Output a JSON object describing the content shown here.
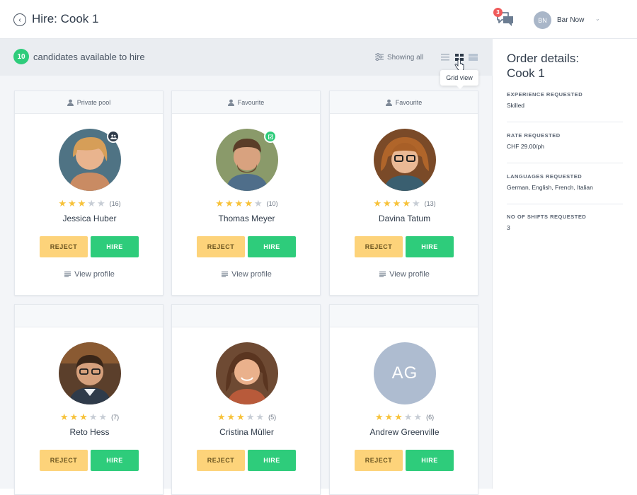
{
  "header": {
    "back_glyph": "‹",
    "title": "Hire: Cook 1",
    "message_count": "3",
    "user_initials": "BN",
    "user_name": "Bar Now",
    "caret": "⌄"
  },
  "subbar": {
    "count": "10",
    "count_label": "candidates available to hire",
    "filter_label": "Showing all",
    "tooltip": "Grid view"
  },
  "candidates": [
    {
      "pool": "Private pool",
      "name": "Jessica Huber",
      "stars": 3,
      "reviews": "(16)",
      "reject": "REJECT",
      "hire": "HIRE",
      "view_profile": "View profile",
      "photo_bg": "#c98b63",
      "badge": "group-icon",
      "badge_color": "#2f3b4a"
    },
    {
      "pool": "Favourite",
      "name": "Thomas Meyer",
      "stars": 4,
      "reviews": "(10)",
      "reject": "REJECT",
      "hire": "HIRE",
      "view_profile": "View profile",
      "photo_bg": "#8a6d52",
      "badge": "favourite-icon",
      "badge_color": "#2ecc7b"
    },
    {
      "pool": "Favourite",
      "name": "Davina Tatum",
      "stars": 4,
      "reviews": "(13)",
      "reject": "REJECT",
      "hire": "HIRE",
      "view_profile": "View profile",
      "photo_bg": "#a8662f"
    },
    {
      "pool": "",
      "name": "Reto Hess",
      "stars": 3,
      "reviews": "(7)",
      "reject": "REJECT",
      "hire": "HIRE",
      "photo_bg": "#5b3f2b"
    },
    {
      "pool": "",
      "name": "Cristina Müller",
      "stars": 3,
      "reviews": "(5)",
      "reject": "REJECT",
      "hire": "HIRE",
      "photo_bg": "#6e4a33"
    },
    {
      "pool": "",
      "name": "Andrew Greenville",
      "stars": 3,
      "reviews": "(6)",
      "reject": "REJECT",
      "hire": "HIRE",
      "initials": "AG",
      "photo_bg": "#aebcd0"
    }
  ],
  "order": {
    "title_line1": "Order details:",
    "title_line2": "Cook  1",
    "sections": [
      {
        "label": "EXPERIENCE REQUESTED",
        "value": "Skilled"
      },
      {
        "label": "RATE REQUESTED",
        "value": "CHF 29.00/ph"
      },
      {
        "label": "LANGUAGES REQUESTED",
        "value": "German, English, French, Italian"
      },
      {
        "label": "NO OF SHIFTS REQUESTED",
        "value": "3"
      }
    ]
  },
  "colors": {
    "accent_green": "#2ecc7b",
    "reject_yellow": "#fdd37a",
    "star": "#f7c23a",
    "badge_red": "#ef5b5b"
  }
}
